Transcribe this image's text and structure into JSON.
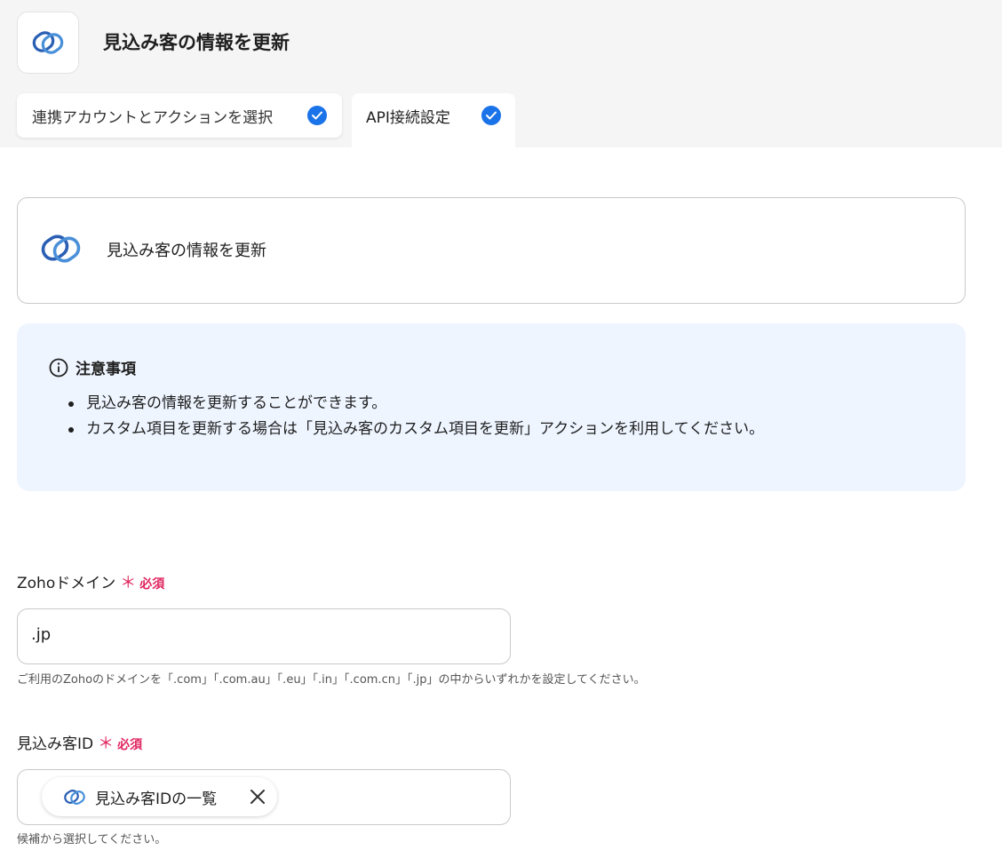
{
  "header": {
    "title": "見込み客の情報を更新",
    "app_icon": "zoho-logo-icon"
  },
  "tabs": [
    {
      "label": "連携アカウントとアクションを選択",
      "completed": true
    },
    {
      "label": "API接続設定",
      "completed": true
    }
  ],
  "action_card": {
    "icon": "zoho-logo-icon",
    "label": "見込み客の情報を更新"
  },
  "notice": {
    "title": "注意事項",
    "icon": "info-icon",
    "items": [
      "見込み客の情報を更新することができます。",
      "カスタム項目を更新する場合は「見込み客のカスタム項目を更新」アクションを利用してください。"
    ]
  },
  "fields": {
    "domain": {
      "label": "Zohoドメイン",
      "required_star": "＊",
      "required_text": "必須",
      "value": ".jp",
      "help": "ご利用のZohoのドメインを「.com」「.com.au」「.eu」「.in」「.com.cn」「.jp」の中からいずれかを設定してください。"
    },
    "lead_id": {
      "label": "見込み客ID",
      "required_star": "＊",
      "required_text": "必須",
      "chip_label": "見込み客IDの一覧",
      "help": "候補から選択してください。"
    }
  },
  "colors": {
    "accent": "#1a73e8",
    "required": "#e0245e",
    "notice_bg": "#eef5ff"
  }
}
